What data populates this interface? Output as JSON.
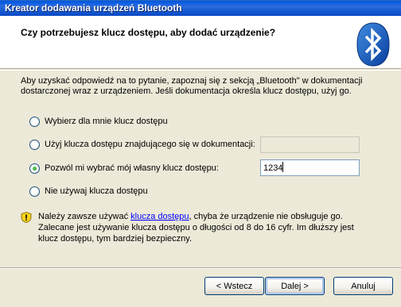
{
  "window": {
    "title": "Kreator dodawania urządzeń Bluetooth"
  },
  "header": {
    "title": "Czy potrzebujesz klucz dostępu, aby dodać urządzenie?",
    "logo_icon": "bluetooth-icon"
  },
  "intro_text": "Aby uzyskać odpowiedź na to pytanie, zapoznaj się z sekcją „Bluetooth\" w dokumentacji dostarczonej wraz z urządzeniem. Jeśli dokumentacja określa klucz dostępu, użyj go.",
  "options": [
    {
      "label": "Wybierz dla mnie klucz dostępu",
      "selected": false
    },
    {
      "label": "Użyj klucza dostępu znajdującego się w dokumentacji:",
      "selected": false,
      "value": ""
    },
    {
      "label": "Pozwól mi wybrać mój własny klucz dostępu:",
      "selected": true,
      "value": "1234"
    },
    {
      "label": "Nie używaj klucza dostępu",
      "selected": false
    }
  ],
  "warning": {
    "icon": "shield-warning-icon",
    "before_link": "Należy zawsze używać ",
    "link": "klucza dostępu",
    "after_link": ", chyba że urządzenie nie obsługuje go. Zalecane jest używanie klucza dostępu o długości od 8 do 16 cyfr. Im dłuższy jest klucz dostępu, tym bardziej bezpieczny."
  },
  "buttons": {
    "back": "< Wstecz",
    "next": "Dalej >",
    "cancel": "Anuluj"
  }
}
